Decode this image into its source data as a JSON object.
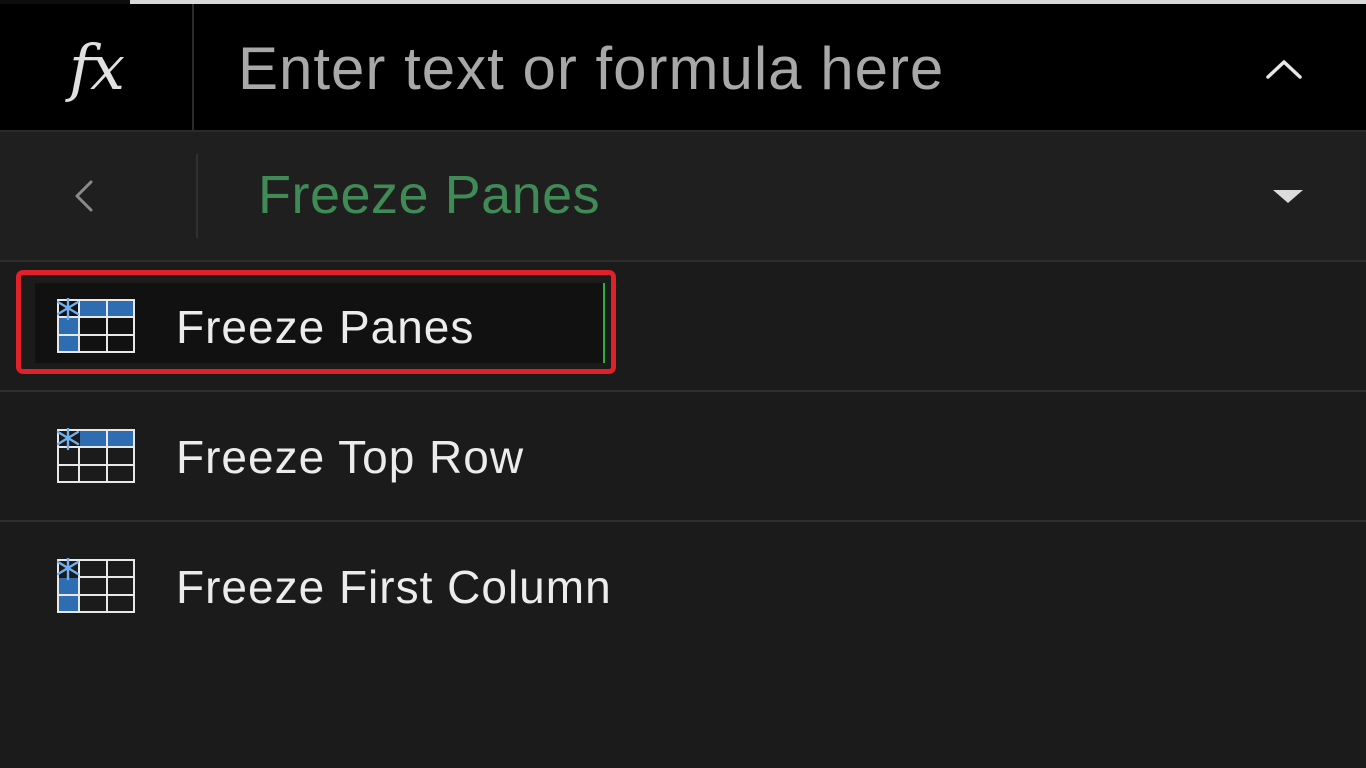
{
  "formula_bar": {
    "fx_label": "fx",
    "placeholder": "Enter text or formula here",
    "collapse_icon": "chevron-up-icon"
  },
  "ribbon_header": {
    "back_icon": "chevron-left-icon",
    "title": "Freeze Panes",
    "title_color": "#3f8a55",
    "dropdown_icon": "caret-down-icon"
  },
  "menu": {
    "items": [
      {
        "label": "Freeze Panes",
        "icon": "freeze-panes-icon",
        "highlighted": true
      },
      {
        "label": "Freeze Top Row",
        "icon": "freeze-top-row-icon",
        "highlighted": false
      },
      {
        "label": "Freeze First Column",
        "icon": "freeze-first-column-icon",
        "highlighted": false
      }
    ]
  },
  "colors": {
    "background": "#1b1b1b",
    "formula_bar_bg": "#000000",
    "highlight_border": "#e0202a",
    "focus_accent": "#2fae3f",
    "icon_blue": "#2f6db3"
  }
}
